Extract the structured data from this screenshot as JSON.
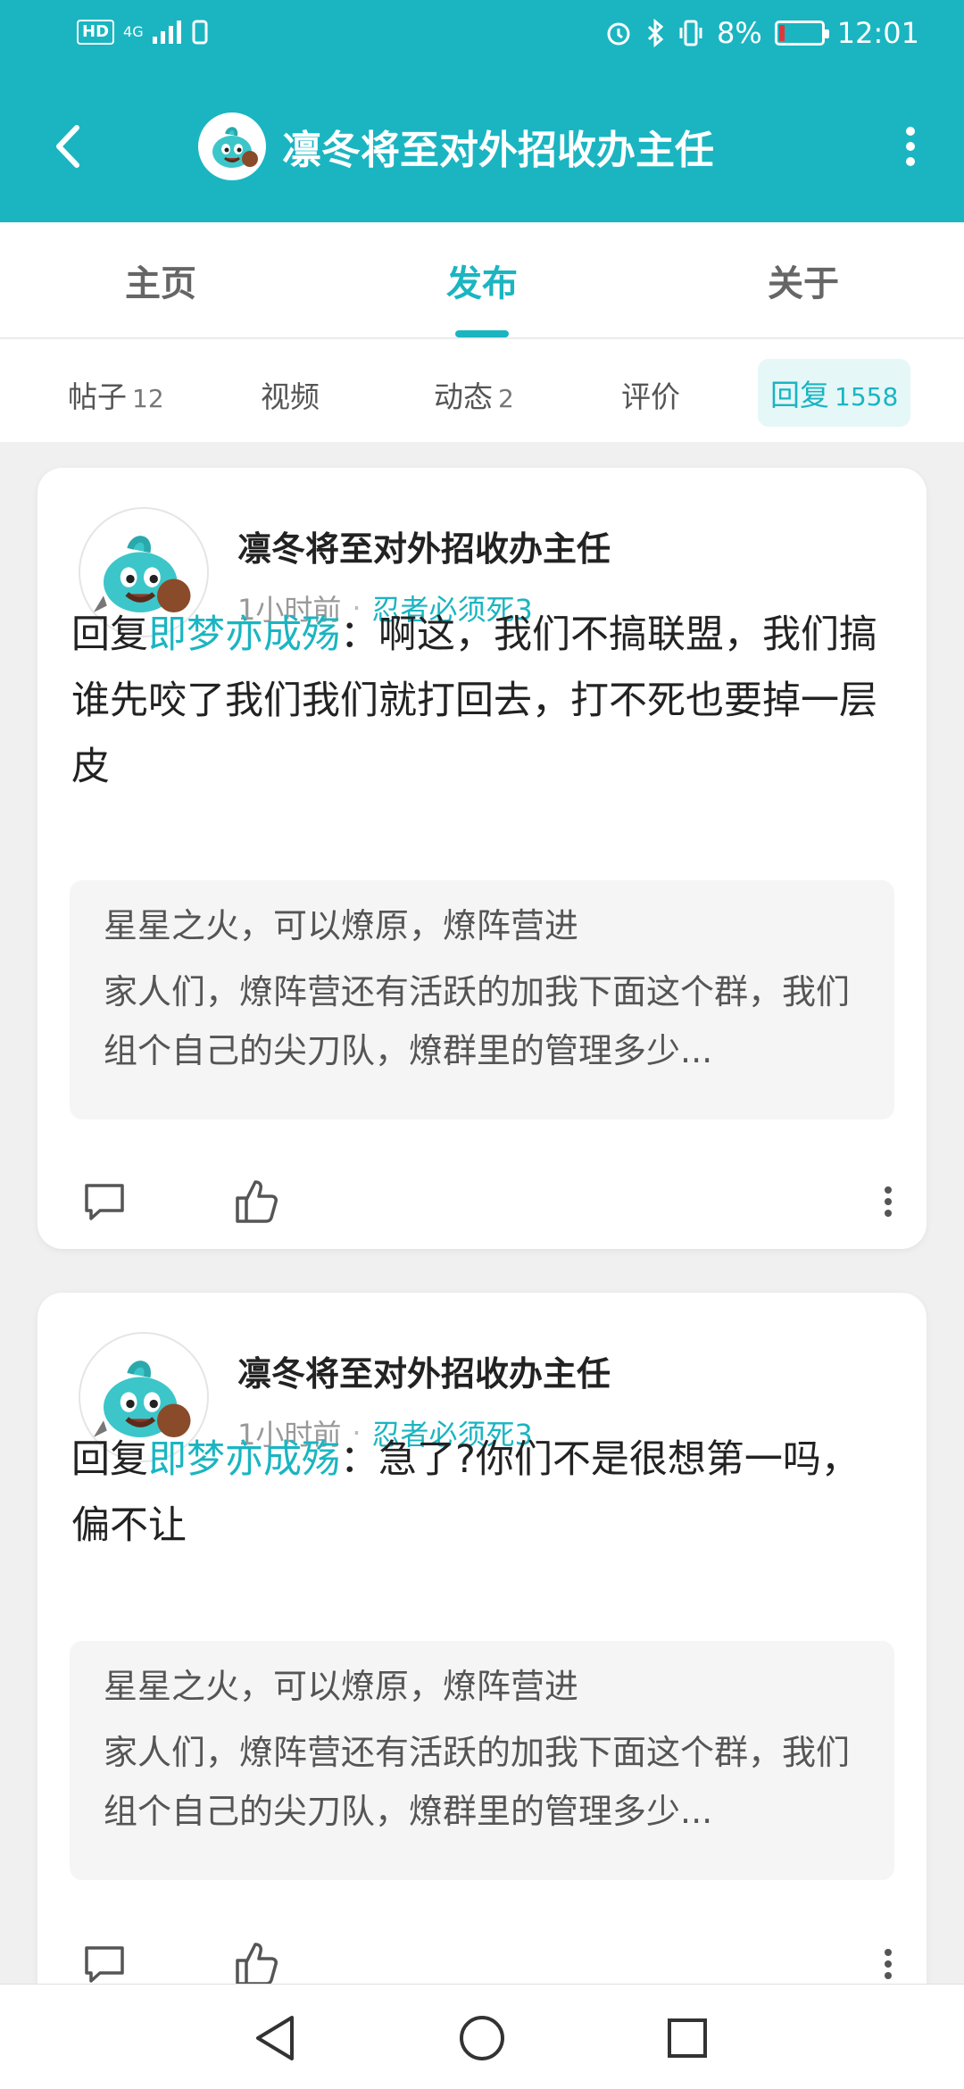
{
  "status_bar": {
    "hd": "HD",
    "network": "4G",
    "battery_pct": "8%",
    "time": "12:01",
    "battery_level": 0.08,
    "battery_low_color": "#e0373a"
  },
  "header": {
    "title": "凛冬将至对外招收办主任",
    "accent": "#1ab5c1",
    "avatar_icon": "slime-mascot-icon"
  },
  "tabs": [
    {
      "label": "主页",
      "active": false
    },
    {
      "label": "发布",
      "active": true
    },
    {
      "label": "关于",
      "active": false
    }
  ],
  "subtabs": [
    {
      "label": "帖子",
      "count": "12"
    },
    {
      "label": "视频",
      "count": ""
    },
    {
      "label": "动态",
      "count": "2"
    },
    {
      "label": "评价",
      "count": ""
    },
    {
      "label": "回复",
      "count": "1558",
      "active": true
    }
  ],
  "posts": [
    {
      "author": "凛冬将至对外招收办主任",
      "time": "1小时前",
      "forum": "忍者必须死3",
      "reply_prefix": "回复",
      "mention": "即梦亦成殇",
      "colon": "：",
      "text": "啊这，我们不搞联盟，我们搞谁先咬了我们我们就打回去，打不死也要掉一层皮",
      "quote_title": "星星之火，可以燎原，燎阵营进",
      "quote_text": "家人们，燎阵营还有活跃的加我下面这个群，我们组个自己的尖刀队，燎群里的管理多少..."
    },
    {
      "author": "凛冬将至对外招收办主任",
      "time": "1小时前",
      "forum": "忍者必须死3",
      "reply_prefix": "回复",
      "mention": "即梦亦成殇",
      "colon": "：",
      "text": "急了?你们不是很想第一吗，偏不让",
      "quote_title": "星星之火，可以燎原，燎阵营进",
      "quote_text": "家人们，燎阵营还有活跃的加我下面这个群，我们组个自己的尖刀队，燎群里的管理多少..."
    }
  ]
}
